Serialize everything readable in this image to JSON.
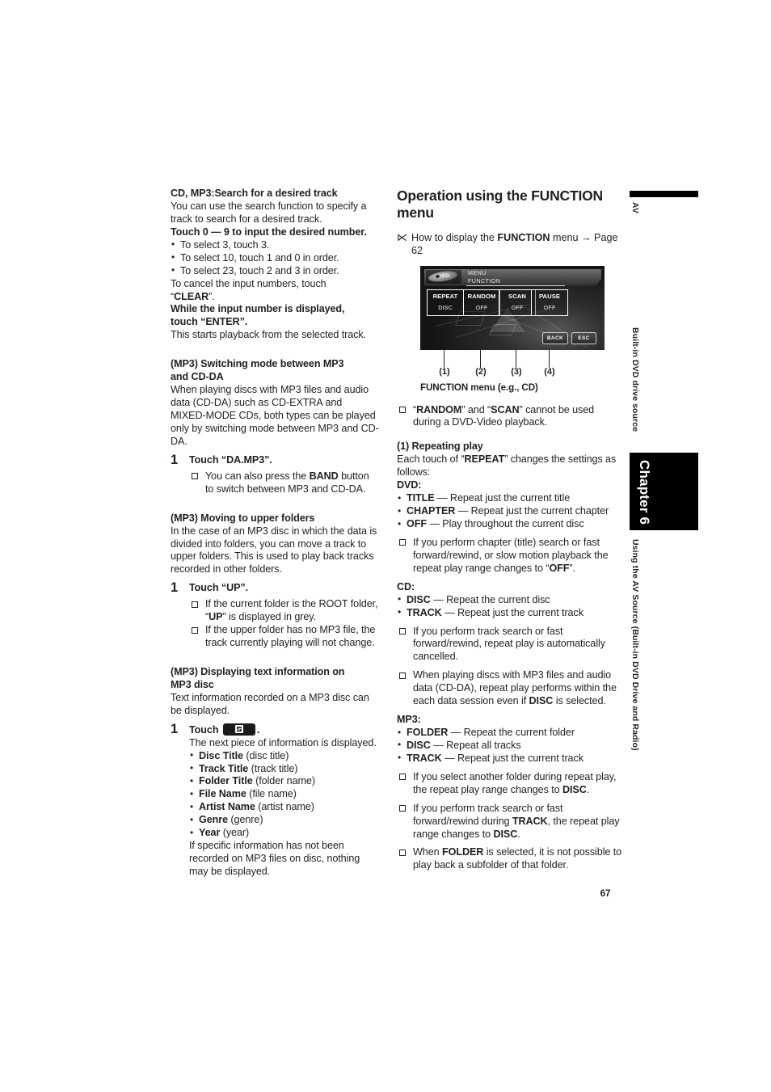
{
  "page": {
    "number": "67",
    "margin": {
      "tab_av": "AV",
      "tab_source": "Built-in DVD drive source",
      "chapter": "Chapter 6",
      "running_head": "Using the AV Source (Built-in DVD Drive and Radio)"
    }
  },
  "left_column": {
    "section1": {
      "heading": "CD, MP3:Search for a desired track",
      "intro": "You can use the search function to specify a track to search for a desired track.",
      "instruction": "Touch 0 — 9 to input the desired number.",
      "bullets": [
        "To select 3, touch 3.",
        "To select 10, touch 1 and 0 in order.",
        "To select 23, touch 2 and 3 in order."
      ],
      "cancel_text_pre": "To cancel the input numbers, touch",
      "cancel_key": "CLEAR",
      "enter_instruction_line1": "While the input number is displayed,",
      "enter_instruction_line2_pre": "touch “",
      "enter_key": "ENTER",
      "enter_instruction_line2_post": "”.",
      "result": "This starts playback from the selected track."
    },
    "section2": {
      "heading_line1": "(MP3) Switching mode between MP3",
      "heading_line2": "and CD-DA",
      "body": "When playing discs with MP3 files and audio data (CD-DA) such as CD-EXTRA and MIXED-MODE CDs, both types can be played only by switching mode between MP3 and CD-DA.",
      "step_number": "1",
      "step_title": "Touch “DA.MP3”.",
      "note_pre": "You can also press the ",
      "note_key": "BAND",
      "note_post": " button to switch between MP3 and CD-DA."
    },
    "section3": {
      "heading": "(MP3) Moving to upper folders",
      "body": "In the case of an MP3 disc in which the data is divided into folders, you can move a track to upper folders. This is used to play back tracks recorded in other folders.",
      "step_number": "1",
      "step_title": "Touch “UP”.",
      "note1_pre": "If the current folder is the ROOT folder, “",
      "note1_key": "UP",
      "note1_post": "” is displayed in grey.",
      "note2": "If the upper folder has no MP3 file, the track currently playing will not change."
    },
    "section4": {
      "heading_line1": "(MP3) Displaying text information on",
      "heading_line2": "MP3 disc",
      "body": "Text information recorded on a MP3 disc can be displayed.",
      "step_number": "1",
      "step_title_pre": "Touch",
      "step_title_icon": "text-display-key-icon",
      "step_title_post": ".",
      "step_body": "The next piece of information is displayed.",
      "items": [
        {
          "term": "Disc Title",
          "desc": "(disc title)"
        },
        {
          "term": "Track Title",
          "desc": "(track title)"
        },
        {
          "term": "Folder Title",
          "desc": "(folder name)"
        },
        {
          "term": "File Name",
          "desc": "(file name)"
        },
        {
          "term": "Artist Name",
          "desc": "(artist name)"
        },
        {
          "term": "Genre",
          "desc": "(genre)"
        },
        {
          "term": "Year",
          "desc": "(year)"
        }
      ],
      "footer": "If specific information has not been recorded on MP3 files on disc, nothing may be displayed."
    }
  },
  "right_column": {
    "heading_line1": "Operation using the FUNCTION",
    "heading_line2": "menu",
    "refnote_pre": "How to display the ",
    "refnote_key": "FUNCTION",
    "refnote_post": " menu → Page 62",
    "screen": {
      "disc_label": "CD",
      "menu_line1": "MENU",
      "menu_line2": "FUNCTION",
      "options": [
        {
          "title": "REPEAT",
          "value": "DISC"
        },
        {
          "title": "RANDOM",
          "value": "OFF"
        },
        {
          "title": "SCAN",
          "value": "OFF"
        },
        {
          "title": "PAUSE",
          "value": "OFF"
        }
      ],
      "back_button": "BACK",
      "esc_button": "ESC"
    },
    "callouts": [
      "(1)",
      "(2)",
      "(3)",
      "(4)"
    ],
    "caption_bold": "FUNCTION",
    "caption_rest": " menu (e.g., CD)",
    "note_top_pre": "“",
    "note_top_k1": "RANDOM",
    "note_top_mid": "” and “",
    "note_top_k2": "SCAN",
    "note_top_post": "” cannot be used during a DVD-Video playback.",
    "sub1": {
      "heading": "(1) Repeating play",
      "intro_pre": "Each touch of “",
      "intro_key": "REPEAT",
      "intro_post": "” changes the settings as follows:",
      "dvd_label": "DVD:",
      "dvd_items": [
        {
          "term": "TITLE",
          "desc": " — Repeat just the current title"
        },
        {
          "term": "CHAPTER",
          "desc": " — Repeat just the current chapter"
        },
        {
          "term": "OFF",
          "desc": " — Play throughout the current disc"
        }
      ],
      "dvd_note_pre": "If you perform chapter (title) search or fast forward/rewind, or slow motion playback the repeat play range changes to “",
      "dvd_note_key": "OFF",
      "dvd_note_post": "”.",
      "cd_label": "CD:",
      "cd_items": [
        {
          "term": "DISC",
          "desc": " — Repeat the current disc"
        },
        {
          "term": "TRACK",
          "desc": " — Repeat just the current track"
        }
      ],
      "cd_note1": "If you perform track search or fast forward/rewind, repeat play is automatically cancelled.",
      "cd_note2_pre": "When playing discs with MP3 files and audio data (CD-DA), repeat play performs within the each data session even if ",
      "cd_note2_key": "DISC",
      "cd_note2_post": " is selected.",
      "mp3_label": "MP3:",
      "mp3_items": [
        {
          "term": "FOLDER",
          "desc": " — Repeat the current folder"
        },
        {
          "term": "DISC",
          "desc": " — Repeat all tracks"
        },
        {
          "term": "TRACK",
          "desc": " — Repeat just the current track"
        }
      ],
      "mp3_note1_pre": "If you select another folder during repeat play, the repeat play range changes to ",
      "mp3_note1_key": "DISC",
      "mp3_note1_post": ".",
      "mp3_note2_pre": "If you perform track search or fast forward/rewind during ",
      "mp3_note2_key1": "TRACK",
      "mp3_note2_mid": ", the repeat play range changes to ",
      "mp3_note2_key2": "DISC",
      "mp3_note2_post": ".",
      "mp3_note3_pre": "When ",
      "mp3_note3_key": "FOLDER",
      "mp3_note3_post": " is selected, it is not possible to play back a subfolder of that folder."
    }
  }
}
